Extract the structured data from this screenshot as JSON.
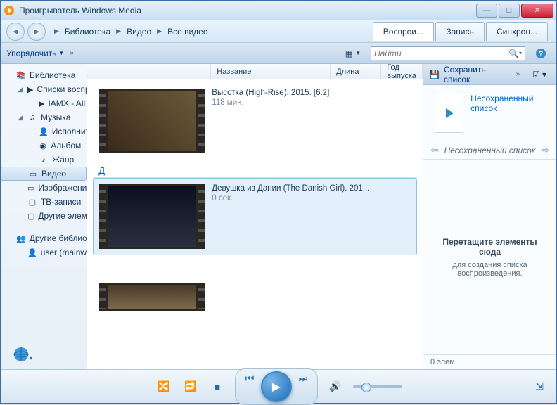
{
  "window": {
    "title": "Проигрыватель Windows Media"
  },
  "breadcrumb": [
    "Библиотека",
    "Видео",
    "Все видео"
  ],
  "tabs": {
    "play": "Воспрои...",
    "burn": "Запись",
    "sync": "Синхрон..."
  },
  "toolbar": {
    "organize": "Упорядочить",
    "search_placeholder": "Найти",
    "save_list": "Сохранить список"
  },
  "sidebar": {
    "library": "Библиотека",
    "playlists": "Списки воспроизве",
    "playlist_item": "IAMX - All album",
    "music": "Музыка",
    "artist": "Исполнитель",
    "album": "Альбом",
    "genre": "Жанр",
    "video": "Видео",
    "images": "Изображения",
    "tv": "ТВ-записи",
    "other": "Другие элементы м",
    "other_libs": "Другие библиотеки",
    "user": "user (mainwork)"
  },
  "columns": {
    "name": "Название",
    "length": "Длина",
    "year": "Год выпуска"
  },
  "videos": [
    {
      "title": "Высотка (High-Rise). 2015. [6.2]",
      "length": "118 мин."
    },
    {
      "title": "Девушка из Дании (The Danish Girl). 201...",
      "length": "0 сек."
    }
  ],
  "letter_d": "Д",
  "playlist": {
    "unsaved": "Несохраненный список",
    "nav_label": "Несохраненный список",
    "drop_head": "Перетащите элементы сюда",
    "drop_sub1": "для создания списка",
    "drop_sub2": "воспроизведения.",
    "status": "0 элем."
  }
}
